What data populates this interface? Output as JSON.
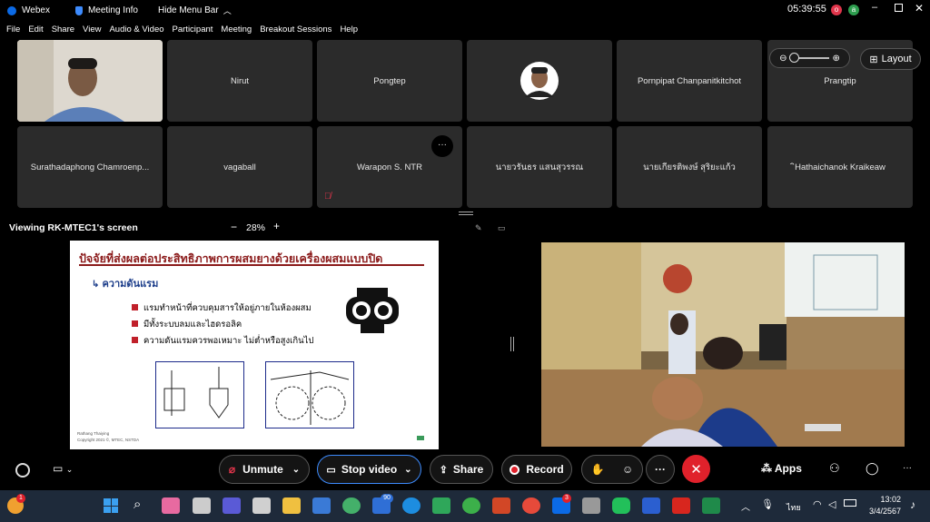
{
  "titlebar": {
    "app_name": "Webex",
    "meeting_info": "Meeting Info",
    "hide_menu": "Hide Menu Bar",
    "time": "05:39:55",
    "avatar_letter": "o",
    "badge_letter": "a"
  },
  "menu": [
    "File",
    "Edit",
    "Share",
    "View",
    "Audio & Video",
    "Participant",
    "Meeting",
    "Breakout Sessions",
    "Help"
  ],
  "layout_button": "Layout",
  "participants_row1": [
    "Nirut",
    "Pongtep",
    "",
    "Pornpipat Chanpanitkitchot",
    "Prangtip"
  ],
  "participants_row2": [
    "Surathadaphong Chamroenp...",
    "vagaball",
    "Warapon S. NTR",
    "นายวรันธร แสนสุวรรณ",
    "นายเกียรติพงษ์ สุริยะแก้ว",
    "ิHathaichanok Kraikeaw"
  ],
  "share": {
    "viewing": "Viewing RK-MTEC1's screen",
    "zoom": "28%"
  },
  "slide": {
    "title": "ปัจจัยที่ส่งผลต่อประสิทธิภาพการผสมยางด้วยเครื่องผสมแบบปิด",
    "heading": "ความดันแรม",
    "bullets": [
      "แรมทำหน้าที่ควบคุมสารให้อยู่ภายในห้องผสม",
      "มีทั้งระบบลมและไฮดรอลิค",
      "ความดันแรมควรพอเหมาะ ไม่ต่ำหรือสูงเกินไป"
    ],
    "footer_1": "Rathang Thaiying",
    "footer_2": "Copyright 2021 ©, MTEC, NSTDA"
  },
  "controls": {
    "unmute": "Unmute",
    "stop_video": "Stop video",
    "share": "Share",
    "record": "Record",
    "more": "···",
    "apps": "Apps",
    "overflow": "···"
  },
  "taskbar": {
    "clock_time": "13:02",
    "clock_date": "3/4/2567",
    "lang": "ไทย",
    "badge_word": "90",
    "badge_teams": "3",
    "badge_red": "1"
  },
  "colors": {
    "tile_bg": "#2b2b2b",
    "end_call": "#e0212b",
    "accent": "#0b6ae6",
    "slide_title_color": "#8b1a1a"
  }
}
